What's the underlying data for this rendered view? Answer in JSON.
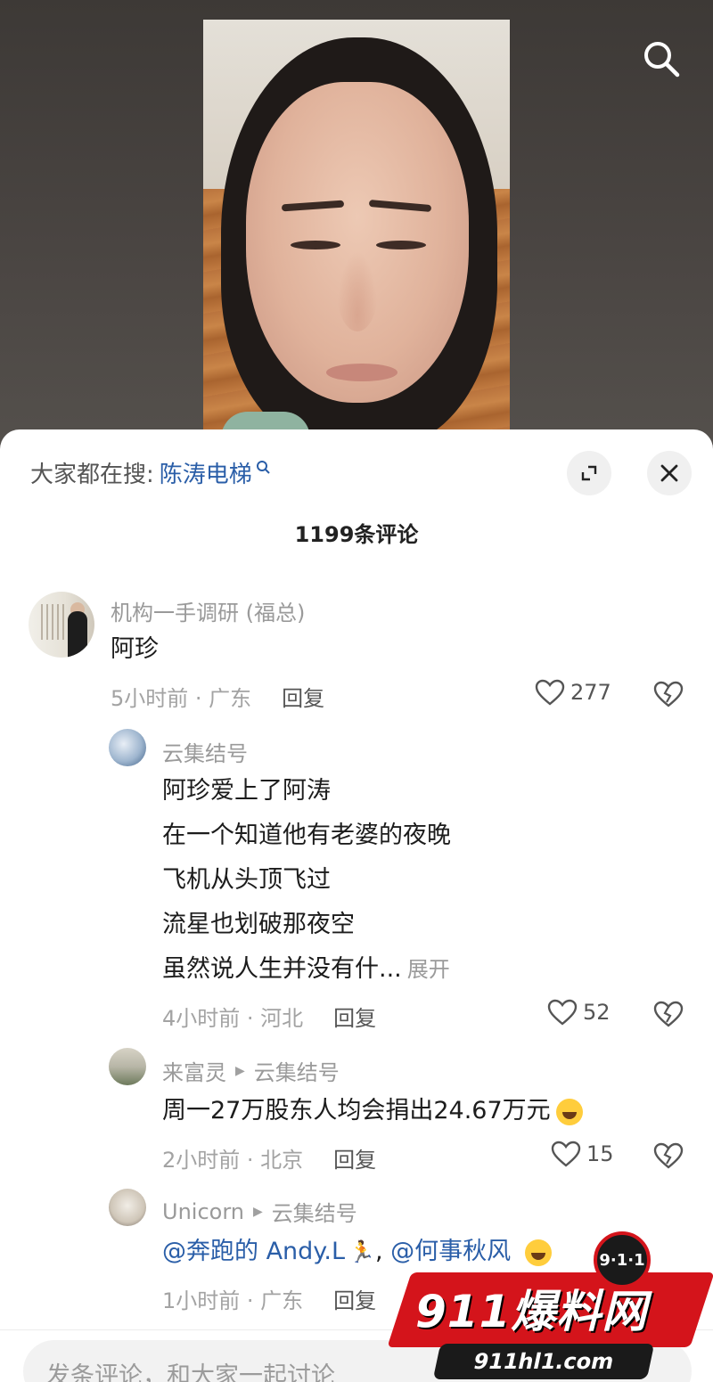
{
  "header": {
    "search_icon": "search-icon"
  },
  "sheet": {
    "hot_search_label": "大家都在搜:",
    "hot_search_term": "陈涛电梯",
    "expand_icon": "expand-icon",
    "close_icon": "close-icon",
    "comment_count": "1199条评论"
  },
  "comments": [
    {
      "user": "机构一手调研 (福总)",
      "text": "阿珍",
      "time": "5小时前 · 广东",
      "reply": "回复",
      "likes": "277"
    }
  ],
  "replies": [
    {
      "user": "云集结号",
      "lines": [
        "阿珍爱上了阿涛",
        "在一个知道他有老婆的夜晚",
        "飞机从头顶飞过",
        "流星也划破那夜空",
        "虽然说人生并没有什..."
      ],
      "more": "展开",
      "time": "4小时前 · 河北",
      "reply": "回复",
      "likes": "52"
    },
    {
      "user": "来富灵",
      "reply_to": "云集结号",
      "text": "周一27万股东人均会捐出24.67万元",
      "time": "2小时前 · 北京",
      "reply": "回复",
      "likes": "15"
    },
    {
      "user": "Unicorn",
      "reply_to": "云集结号",
      "mention1": "@奔跑的 Andy.L",
      "separator": ", ",
      "mention2": "@何事秋风",
      "time": "1小时前 · 广东",
      "reply": "回复"
    }
  ],
  "input": {
    "placeholder": "发条评论，和大家一起讨论"
  },
  "watermark": {
    "badge": "9·1·1",
    "title": "911爆料网",
    "url": "911hl1.com"
  },
  "colors": {
    "accent_link": "#2a5ea8",
    "watermark_red": "#d4141b"
  }
}
